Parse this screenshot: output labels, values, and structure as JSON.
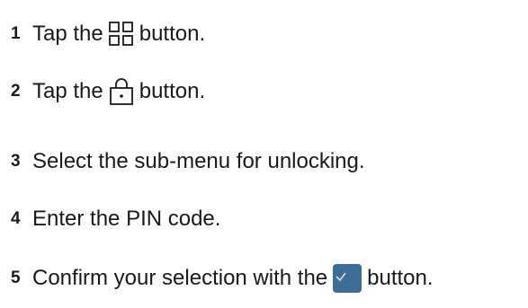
{
  "steps": [
    {
      "number": "1",
      "before": "Tap the",
      "icon": "app-grid-icon",
      "after": "button."
    },
    {
      "number": "2",
      "before": "Tap the",
      "icon": "lock-icon",
      "after": "button."
    },
    {
      "number": "3",
      "text": "Select the sub-menu for unlocking."
    },
    {
      "number": "4",
      "text": "Enter the PIN code."
    },
    {
      "number": "5",
      "before": "Confirm your selection with the",
      "icon": "checkmark-confirm-icon",
      "after": "button."
    }
  ],
  "colors": {
    "text": "#1a1a1a",
    "confirm_button": "#3d6c97",
    "checkmark": "#cfe0f0"
  }
}
